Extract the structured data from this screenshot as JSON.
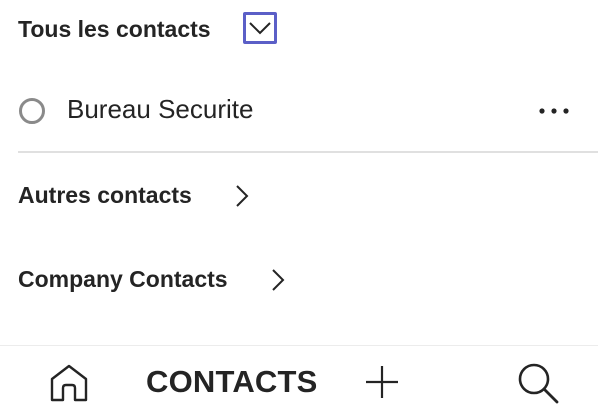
{
  "header": {
    "group_title": "Tous les contacts",
    "dropdown_icon": "chevron-down-icon"
  },
  "contacts": [
    {
      "name": "Bureau Securite",
      "presence_icon": "presence-ring-icon",
      "more_icon": "more-horizontal-icon"
    }
  ],
  "sections": [
    {
      "label": "Autres contacts",
      "icon": "chevron-right-icon"
    },
    {
      "label": "Company Contacts",
      "icon": "chevron-right-icon"
    }
  ],
  "bottom_nav": {
    "home_icon": "home-icon",
    "title": "CONTACTS",
    "add_icon": "plus-icon",
    "search_icon": "search-icon"
  },
  "colors": {
    "text": "#242424",
    "focus_outline": "#5b5fc7",
    "divider": "#e0e0e0",
    "icon_gray": "#8a8a8a"
  }
}
